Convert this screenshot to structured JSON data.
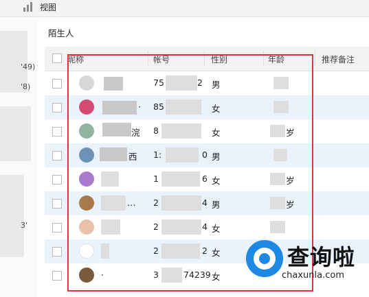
{
  "toolbar": {
    "view_label": "视图",
    "view_icon": "bar-chart-icon"
  },
  "section": {
    "title": "陌生人"
  },
  "table": {
    "columns": [
      "昵称",
      "帐号",
      "性别",
      "年龄",
      "推荐备注"
    ],
    "rows": [
      {
        "nickname": "",
        "account": "75",
        "account_tail": "2",
        "gender": "男",
        "age": ""
      },
      {
        "nickname": "·",
        "account": "85",
        "account_tail": "",
        "gender": "女",
        "age": ""
      },
      {
        "nickname": "浣",
        "account": "8",
        "account_tail": "",
        "gender": "女",
        "age": "岁"
      },
      {
        "nickname": "西",
        "account": "1:",
        "account_tail": "0",
        "gender": "男",
        "age": ""
      },
      {
        "nickname": "",
        "account": "1",
        "account_tail": "6",
        "gender": "女",
        "age": "岁"
      },
      {
        "nickname": "…",
        "account": "2",
        "account_tail": "4",
        "gender": "男",
        "age": "岁"
      },
      {
        "nickname": "",
        "account": "2",
        "account_tail": "4",
        "gender": "女",
        "age": ""
      },
      {
        "nickname": "",
        "account": "2",
        "account_tail": "2",
        "gender": "女",
        "age": ""
      },
      {
        "nickname": "·",
        "account": "3",
        "account_tail": "74239",
        "gender": "女",
        "age": ""
      }
    ]
  },
  "left_panel": {
    "fragments": [
      "'49)",
      "'8)",
      "3'"
    ]
  },
  "watermark": {
    "brand_cn": "查询啦",
    "brand_en": "chaxunla.com"
  },
  "colors": {
    "highlight_box": "#d9363e",
    "row_alt": "#eaf3fb",
    "brand": "#1e88e5"
  }
}
